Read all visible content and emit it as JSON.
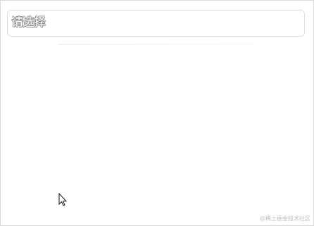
{
  "select": {
    "placeholder": "请选择"
  },
  "watermark": {
    "text": "@稀土掘金技术社区"
  },
  "cursor": {
    "icon": "arrow-cursor-icon"
  }
}
